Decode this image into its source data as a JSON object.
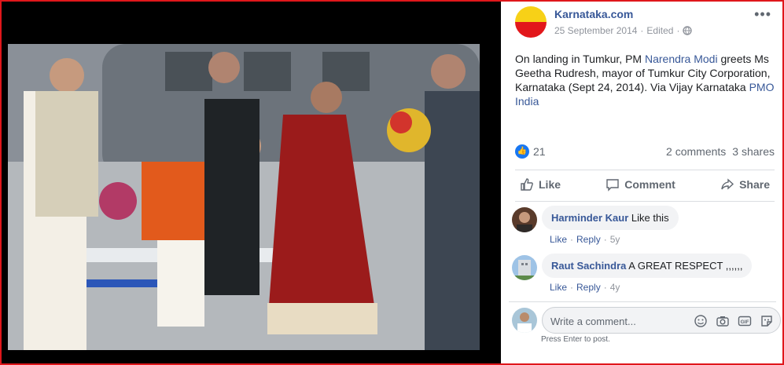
{
  "post": {
    "page_name": "Karnataka.com",
    "date": "25 September 2014",
    "edited": "Edited",
    "menu_icon": "more-horizontal-icon",
    "privacy_icon": "globe-icon",
    "text_before": "On landing in Tumkur, PM ",
    "mention_1": "Narendra Modi",
    "text_middle": " greets Ms Geetha Rudresh, mayor of Tumkur City Corporation, Karnataka (Sept 24, 2014). Via Vijay Karnataka ",
    "mention_2": "PMO India",
    "logo_colors": {
      "top": "#f7d117",
      "bottom": "#e2171b"
    }
  },
  "stats": {
    "reactions": "21",
    "comments": "2 comments",
    "shares": "3 shares"
  },
  "actions": {
    "like": "Like",
    "comment": "Comment",
    "share": "Share"
  },
  "comments": [
    {
      "name": "Harminder Kaur",
      "text": "Like this",
      "like": "Like",
      "reply": "Reply",
      "time": "5y"
    },
    {
      "name": "Raut Sachindra",
      "text": "A GREAT RESPECT ,,,,,,",
      "like": "Like",
      "reply": "Reply",
      "time": "4y"
    }
  ],
  "composer": {
    "placeholder": "Write a comment...",
    "hint": "Press Enter to post.",
    "icons": [
      "emoji-icon",
      "camera-icon",
      "gif-icon",
      "sticker-icon"
    ]
  },
  "colors": {
    "frame": "#e0171b",
    "link": "#385898",
    "like_blue": "#1877f2"
  }
}
